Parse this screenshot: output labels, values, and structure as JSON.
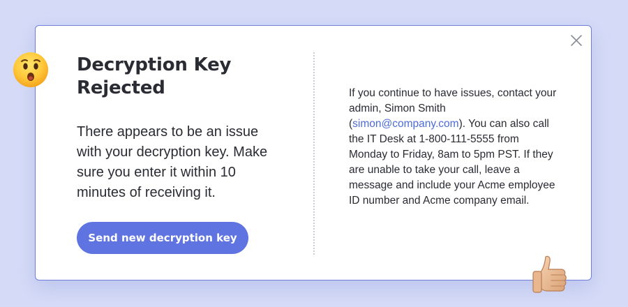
{
  "dialog": {
    "title": "Decryption Key Rejected",
    "message": "There appears to be an issue with your decryption key. Make sure you enter it within 10 minutes of receiving it.",
    "primary_button_label": "Send new decryption key",
    "close_icon": "close-icon"
  },
  "help": {
    "text_before": "If you continue to have issues, contact your admin, Simon Smith (",
    "email": "simon@company.com",
    "text_after": "). You can also call the IT Desk at 1-800-111-5555 from Monday to Friday, 8am to 5pm PST. If they are unable to take your call, leave a message and include your Acme employee ID number and Acme company email."
  },
  "decorations": {
    "left_emoji": "hushed-face-emoji",
    "right_emoji": "thumbs-up-emoji"
  },
  "colors": {
    "background": "#d5dbf7",
    "card_border": "#6f7fd9",
    "accent": "#5f74e0",
    "link": "#4d6bd6",
    "text": "#2a2b33"
  }
}
